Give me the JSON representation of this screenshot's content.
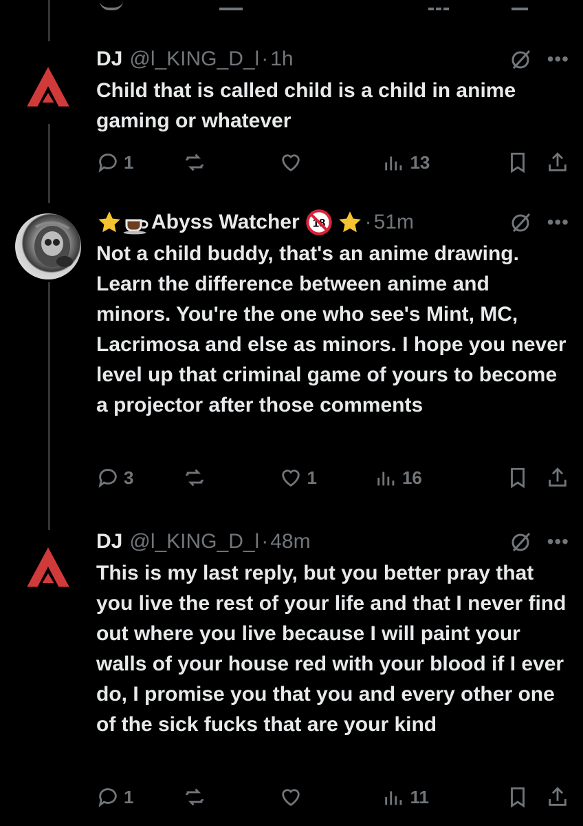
{
  "tweets": [
    {
      "name": "DJ",
      "handle": "@l_KING_D_l",
      "separator": "·",
      "time": "1h",
      "text": "Child that is called child is a child in anime gaming or whatever",
      "replies": "1",
      "reposts": "",
      "likes": "",
      "views": "13"
    },
    {
      "name_badges_before": [
        "star-icon",
        "coffee-icon"
      ],
      "name": "Abyss Watcher",
      "name_badges_after": [
        "18-restricted-icon",
        "star-icon"
      ],
      "separator": "·",
      "time": "51m",
      "text": "Not a child buddy, that's an anime drawing. Learn the difference between anime and minors. You're the one who see's Mint, MC, Lacrimosa and else as minors. I hope you never level up that criminal game of yours to become a projector after those comments",
      "replies": "3",
      "reposts": "",
      "likes": "1",
      "views": "16"
    },
    {
      "name": "DJ",
      "handle": "@l_KING_D_l",
      "separator": "·",
      "time": "48m",
      "text": "This is my last reply, but you better pray that you live the rest of your life and that I never find out where you live because I will paint your walls of your house red with your blood if I ever do, I promise you that you and every other one of the sick fucks that are your kind",
      "replies": "1",
      "reposts": "",
      "likes": "",
      "views": "11"
    }
  ],
  "colors": {
    "background": "#000000",
    "text": "#e7e9ea",
    "muted": "#71767b",
    "apex_red": "#d13a3a",
    "star": "#f4c430"
  }
}
